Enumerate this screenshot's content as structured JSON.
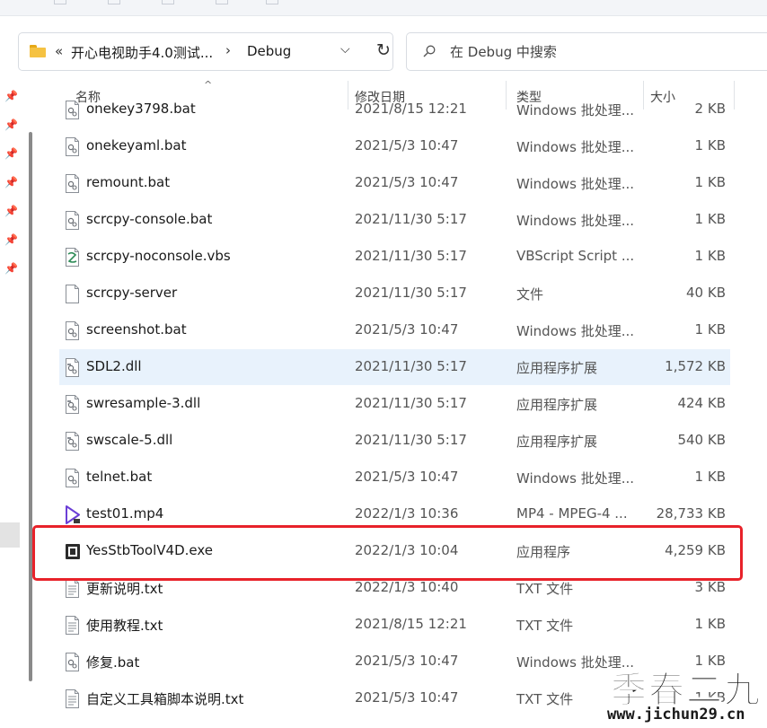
{
  "address_bar": {
    "overflow": "«",
    "crumbs": [
      "开心电视助手4.0测试...",
      "Debug"
    ],
    "separator": "›"
  },
  "search": {
    "placeholder": "在 Debug 中搜索"
  },
  "columns": {
    "name": "名称",
    "date": "修改日期",
    "type": "类型",
    "size": "大小"
  },
  "files": [
    {
      "name": "onekey3798.bat",
      "date": "2021/8/15 12:21",
      "type": "Windows 批处理...",
      "size": "2 KB",
      "icon": "batch-file-icon"
    },
    {
      "name": "onekeyaml.bat",
      "date": "2021/5/3 10:47",
      "type": "Windows 批处理...",
      "size": "1 KB",
      "icon": "batch-file-icon"
    },
    {
      "name": "remount.bat",
      "date": "2021/5/3 10:47",
      "type": "Windows 批处理...",
      "size": "1 KB",
      "icon": "batch-file-icon"
    },
    {
      "name": "scrcpy-console.bat",
      "date": "2021/11/30 5:17",
      "type": "Windows 批处理...",
      "size": "1 KB",
      "icon": "batch-file-icon"
    },
    {
      "name": "scrcpy-noconsole.vbs",
      "date": "2021/11/30 5:17",
      "type": "VBScript Script ...",
      "size": "1 KB",
      "icon": "vbscript-file-icon"
    },
    {
      "name": "scrcpy-server",
      "date": "2021/11/30 5:17",
      "type": "文件",
      "size": "40 KB",
      "icon": "blank-file-icon"
    },
    {
      "name": "screenshot.bat",
      "date": "2021/5/3 10:47",
      "type": "Windows 批处理...",
      "size": "1 KB",
      "icon": "batch-file-icon"
    },
    {
      "name": "SDL2.dll",
      "date": "2021/11/30 5:17",
      "type": "应用程序扩展",
      "size": "1,572 KB",
      "icon": "dll-file-icon"
    },
    {
      "name": "swresample-3.dll",
      "date": "2021/11/30 5:17",
      "type": "应用程序扩展",
      "size": "424 KB",
      "icon": "dll-file-icon"
    },
    {
      "name": "swscale-5.dll",
      "date": "2021/11/30 5:17",
      "type": "应用程序扩展",
      "size": "540 KB",
      "icon": "dll-file-icon"
    },
    {
      "name": "telnet.bat",
      "date": "2021/5/3 10:47",
      "type": "Windows 批处理...",
      "size": "1 KB",
      "icon": "batch-file-icon"
    },
    {
      "name": "test01.mp4",
      "date": "2022/1/3 10:36",
      "type": "MP4 - MPEG-4 ...",
      "size": "28,733 KB",
      "icon": "video-file-icon"
    },
    {
      "name": "YesStbToolV4D.exe",
      "date": "2022/1/3 10:04",
      "type": "应用程序",
      "size": "4,259 KB",
      "icon": "exe-file-icon"
    },
    {
      "name": "更新说明.txt",
      "date": "2022/1/3 10:40",
      "type": "TXT 文件",
      "size": "3 KB",
      "icon": "text-file-icon"
    },
    {
      "name": "使用教程.txt",
      "date": "2021/8/15 12:21",
      "type": "TXT 文件",
      "size": "1 KB",
      "icon": "text-file-icon"
    },
    {
      "name": "修复.bat",
      "date": "2021/5/3 10:47",
      "type": "Windows 批处理...",
      "size": "1 KB",
      "icon": "batch-file-icon"
    },
    {
      "name": "自定义工具箱脚本说明.txt",
      "date": "2021/5/3 10:47",
      "type": "TXT 文件",
      "size": "1 KB",
      "icon": "text-file-icon"
    }
  ],
  "hover_row_index": 7,
  "highlighted_row_index": 12,
  "watermark": {
    "main": "季春二九",
    "url": "www.jichun29.cn"
  },
  "colors": {
    "highlight_border": "#e8222a",
    "hover_row": "#e8f2fc",
    "folder": "#f5c242"
  }
}
